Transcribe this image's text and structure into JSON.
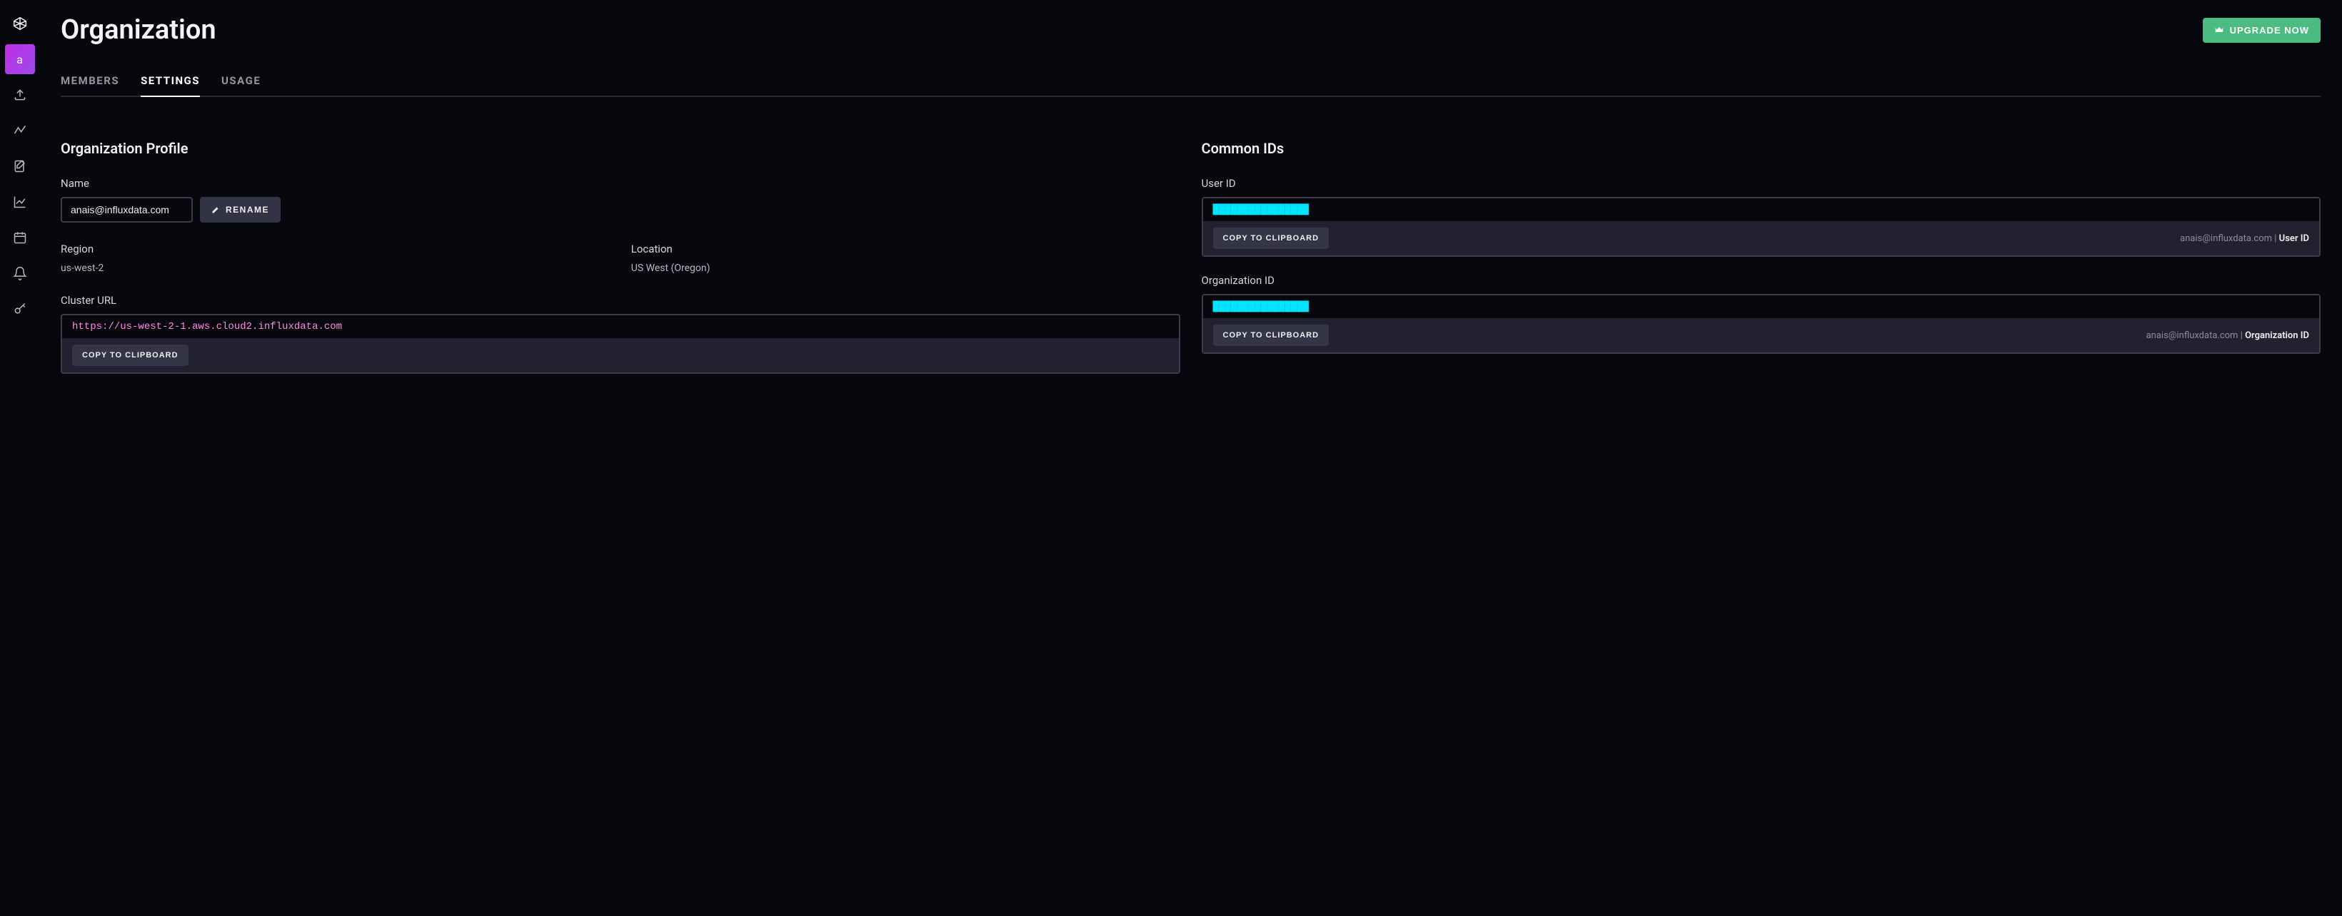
{
  "sidebar": {
    "items": [
      {
        "name": "logo-icon"
      },
      {
        "name": "org-icon",
        "label": "a"
      },
      {
        "name": "upload-icon"
      },
      {
        "name": "explore-icon"
      },
      {
        "name": "notes-icon"
      },
      {
        "name": "graph-icon"
      },
      {
        "name": "calendar-icon"
      },
      {
        "name": "bell-icon"
      },
      {
        "name": "key-icon"
      }
    ]
  },
  "header": {
    "title": "Organization",
    "upgrade": "UPGRADE NOW"
  },
  "tabs": [
    {
      "label": "MEMBERS",
      "active": false
    },
    {
      "label": "SETTINGS",
      "active": true
    },
    {
      "label": "USAGE",
      "active": false
    }
  ],
  "profile": {
    "title": "Organization Profile",
    "name_label": "Name",
    "name_value": "anais@influxdata.com",
    "rename": "RENAME",
    "region_label": "Region",
    "region_value": "us-west-2",
    "location_label": "Location",
    "location_value": "US West (Oregon)",
    "cluster_label": "Cluster URL",
    "cluster_value": "https://us-west-2-1.aws.cloud2.influxdata.com",
    "copy": "COPY TO CLIPBOARD"
  },
  "ids": {
    "title": "Common IDs",
    "user_id_label": "User ID",
    "user_id_value": "████████████████",
    "user_caption_prefix": "anais@influxdata.com | ",
    "user_caption_bold": "User ID",
    "org_id_label": "Organization ID",
    "org_id_value": "████████████████",
    "org_caption_prefix": "anais@influxdata.com | ",
    "org_caption_bold": "Organization ID",
    "copy": "COPY TO CLIPBOARD"
  }
}
